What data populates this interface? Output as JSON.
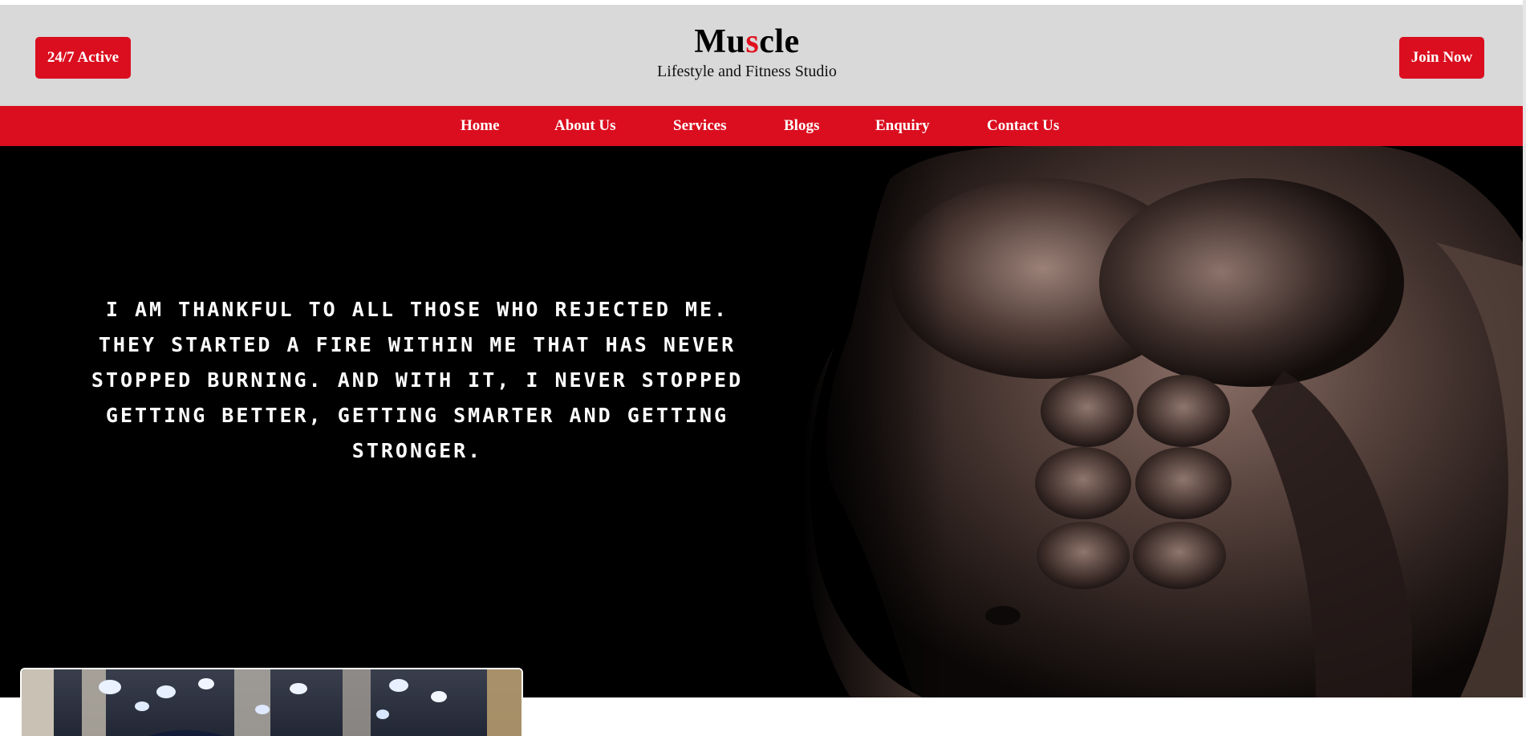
{
  "header": {
    "left_button": "24/7 Active",
    "right_button": "Join Now",
    "logo": {
      "part1": "Mu",
      "accent": "s",
      "part2": "cle"
    },
    "tagline": "Lifestyle and Fitness Studio"
  },
  "nav": {
    "items": [
      {
        "label": "Home"
      },
      {
        "label": "About Us"
      },
      {
        "label": "Services"
      },
      {
        "label": "Blogs"
      },
      {
        "label": "Enquiry"
      },
      {
        "label": "Contact Us"
      }
    ]
  },
  "hero": {
    "quote": "I am thankful to all those who rejected me. They started a fire within me that has never stopped burning. And with it, I never stopped getting better, getting smarter and getting stronger."
  },
  "colors": {
    "brand_red": "#da0e1f",
    "header_gray": "#d9d9d9",
    "hero_black": "#000000"
  }
}
